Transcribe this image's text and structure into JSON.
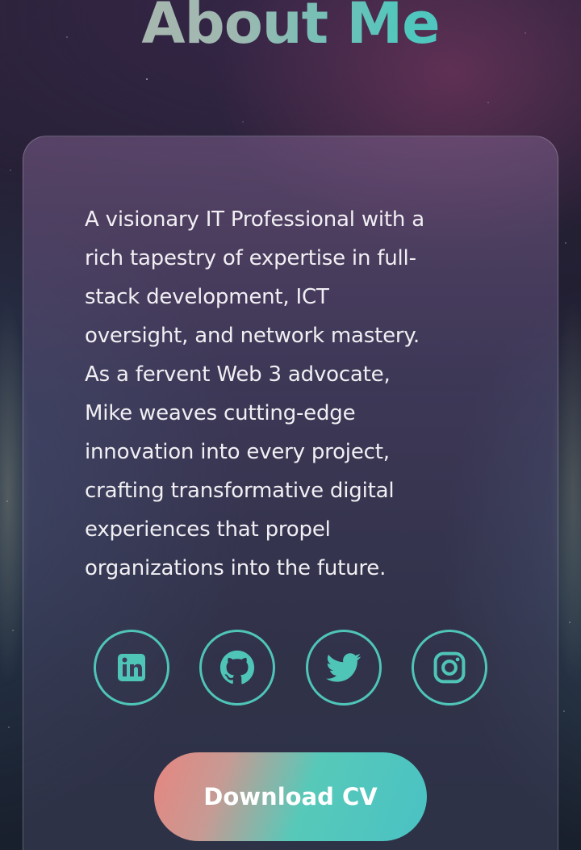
{
  "page": {
    "title": "About Me"
  },
  "about": {
    "bio_lines": [
      "A visionary IT Professional with a",
      "rich tapestry of expertise in full-",
      "stack development, ICT",
      "oversight, and network mastery.",
      "As a fervent Web 3 advocate,",
      "Mike weaves cutting-edge",
      "innovation into every project,",
      "crafting transformative digital",
      "experiences that propel",
      "organizations into the future."
    ]
  },
  "socials": [
    {
      "icon": "linkedin-icon"
    },
    {
      "icon": "github-icon"
    },
    {
      "icon": "twitter-icon"
    },
    {
      "icon": "instagram-icon"
    }
  ],
  "cta": {
    "download_label": "Download CV"
  },
  "colors": {
    "accent_teal": "#4fc5b8",
    "button_gradient_start": "#e88580",
    "button_gradient_end": "#4ac2c4",
    "text": "#f1eff3"
  }
}
